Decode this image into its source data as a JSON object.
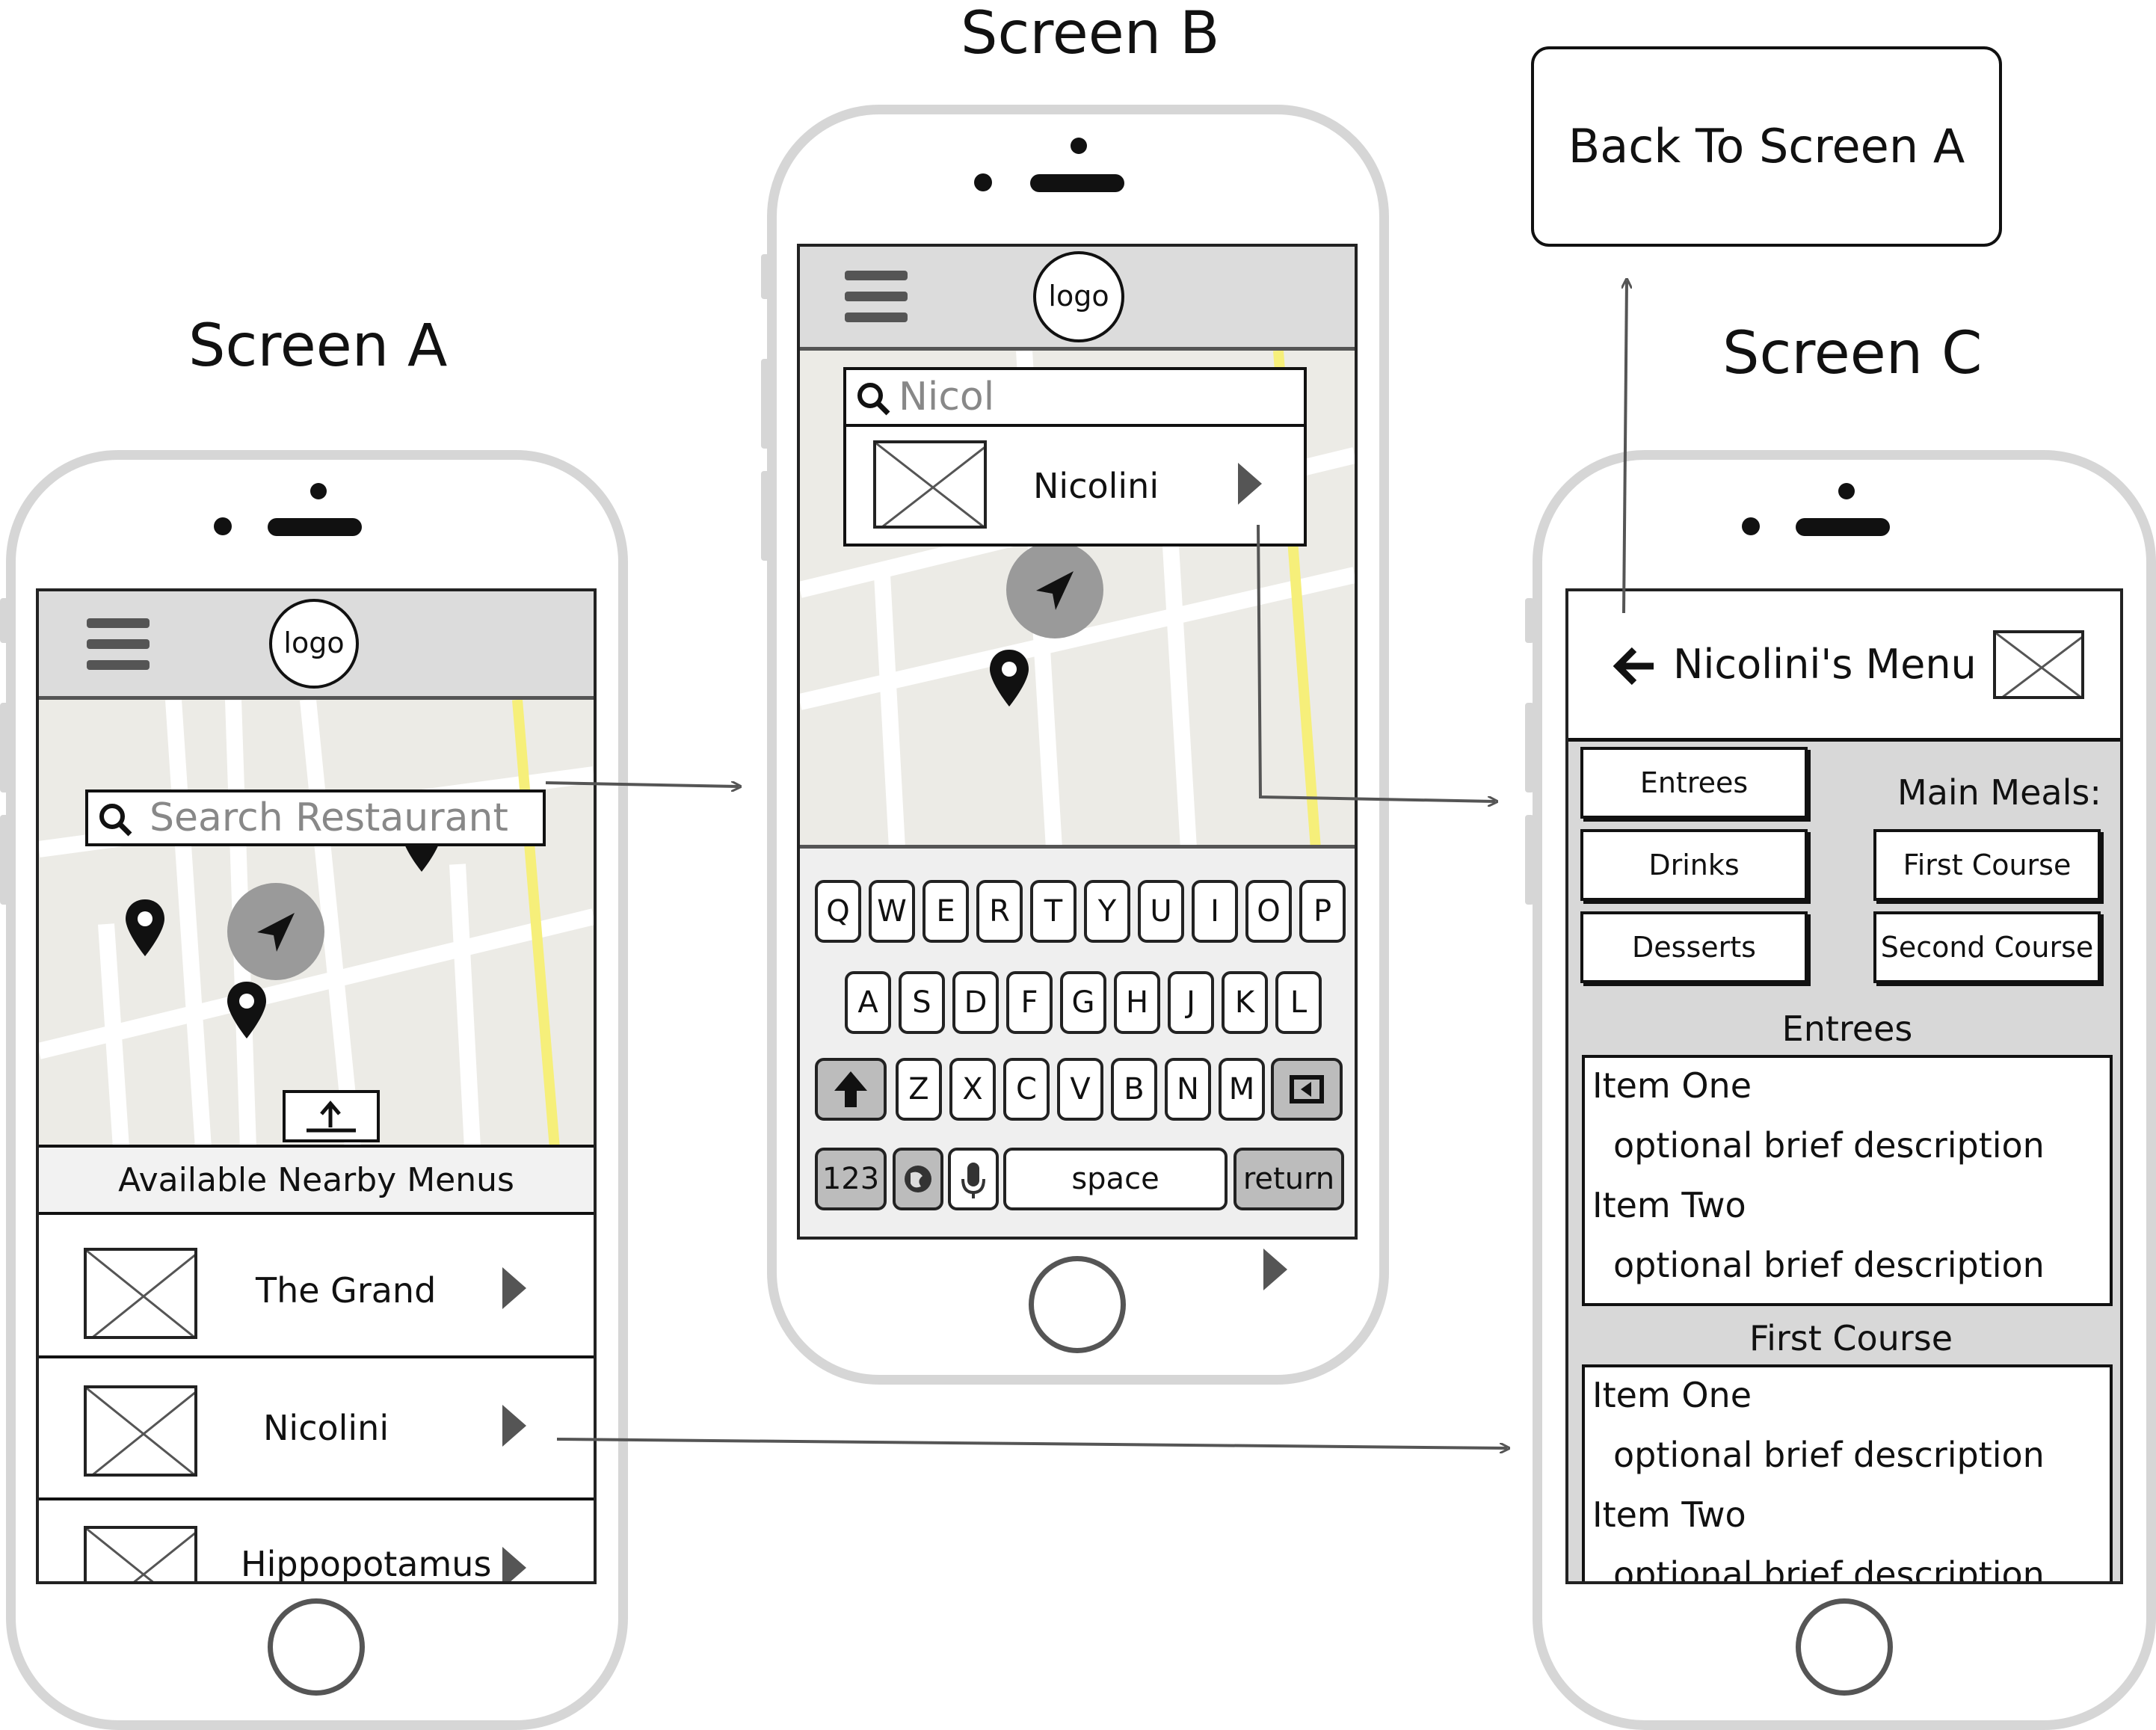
{
  "titles": {
    "screen_a": "Screen A",
    "screen_b": "Screen B",
    "screen_c": "Screen C"
  },
  "back_box": "Back To Screen A",
  "common": {
    "logo": "logo"
  },
  "screen_a": {
    "search_placeholder": "Search Restaurant",
    "list_header": "Available Nearby Menus",
    "restaurants": [
      "The Grand",
      "Nicolini",
      "Hippopotamus"
    ]
  },
  "screen_b": {
    "search_value": "Nicol",
    "result": "Nicolini",
    "keyboard": {
      "row1": [
        "Q",
        "W",
        "E",
        "R",
        "T",
        "Y",
        "U",
        "I",
        "O",
        "P"
      ],
      "row2": [
        "A",
        "S",
        "D",
        "F",
        "G",
        "H",
        "J",
        "K",
        "L"
      ],
      "row3": [
        "Z",
        "X",
        "C",
        "V",
        "B",
        "N",
        "M"
      ],
      "num_key": "123",
      "space_key": "space",
      "return_key": "return"
    }
  },
  "screen_c": {
    "header_title": "Nicolini's Menu",
    "main_meals_label": "Main Meals:",
    "left_buttons": [
      "Entrees",
      "Drinks",
      "Desserts"
    ],
    "right_buttons": [
      "First Course",
      "Second Course"
    ],
    "sections": [
      {
        "title": "Entrees",
        "items": [
          {
            "name": "Item One",
            "desc": "optional brief description"
          },
          {
            "name": "Item Two",
            "desc": "optional brief description"
          }
        ]
      },
      {
        "title": "First Course",
        "items": [
          {
            "name": "Item One",
            "desc": "optional brief description"
          },
          {
            "name": "Item Two",
            "desc": "optional brief description"
          }
        ]
      }
    ]
  }
}
